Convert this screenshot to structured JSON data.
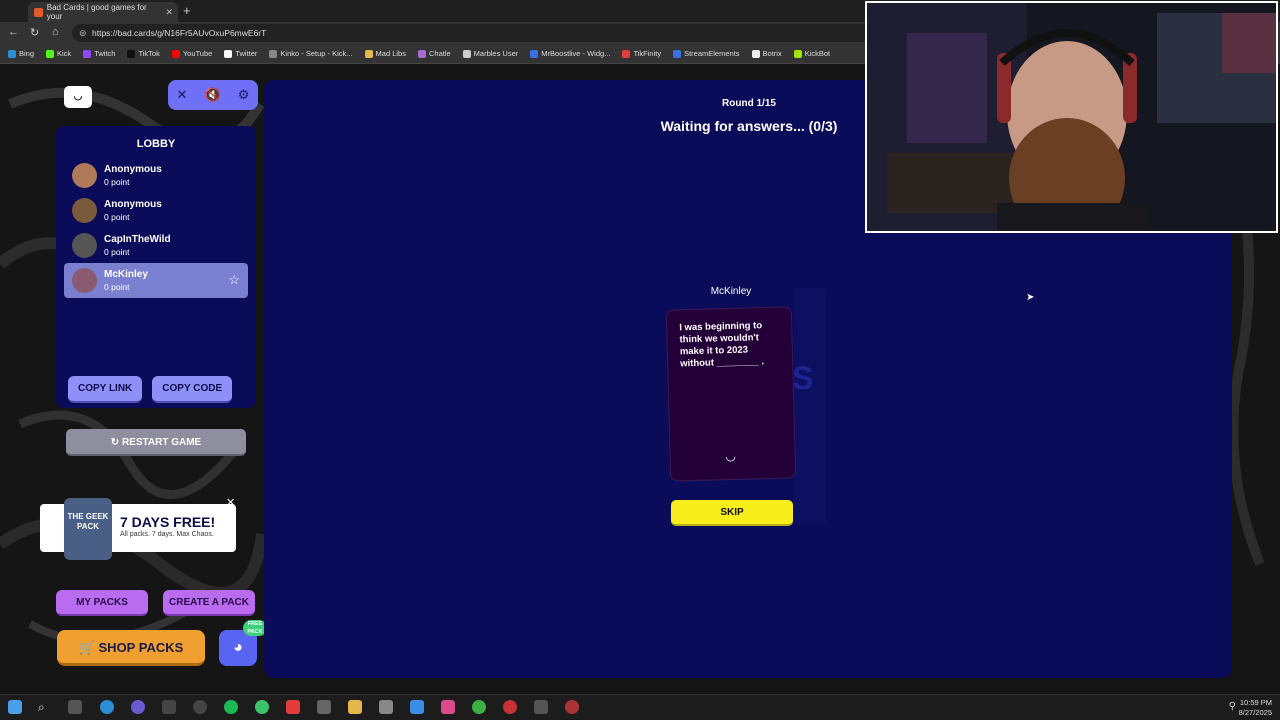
{
  "browser": {
    "tab_title": "Bad Cards | good games for your",
    "url": "https://bad.cards/g/N16Fr5AUvOxuP6mwE6rT",
    "bookmarks": [
      "Bing",
      "Kick",
      "Twitch",
      "TikTok",
      "YouTube",
      "Twitter",
      "Kinko - Setup - Kick...",
      "Mad Libs",
      "Chatle",
      "Marbles User",
      "MrBoostlive - Widg...",
      "TikFinity",
      "StreamElements",
      "Botrix",
      "KickBot"
    ]
  },
  "lobby": {
    "title": "LOBBY",
    "players": [
      {
        "name": "Anonymous",
        "points": "0 point"
      },
      {
        "name": "Anonymous",
        "points": "0 point"
      },
      {
        "name": "CapInTheWild",
        "points": "0 point"
      },
      {
        "name": "McKinley",
        "points": "0 point"
      }
    ],
    "copy_link": "COPY LINK",
    "copy_code": "COPY CODE",
    "restart": "RESTART GAME"
  },
  "promo": {
    "pack_label": "THE GEEK PACK",
    "headline": "7 DAYS FREE!",
    "subline": "All packs. 7 days. Max Chaos."
  },
  "actions": {
    "my_packs": "MY PACKS",
    "create_pack": "CREATE A PACK",
    "shop_packs": "SHOP PACKS",
    "discord_badge": "FREE PACK"
  },
  "game": {
    "round": "Round 1/15",
    "status": "Waiting for answers... (0/3)",
    "card_owner": "McKinley",
    "card_text": "I was beginning to think we wouldn't make it to 2023 without ________ .",
    "skip": "SKIP"
  },
  "system": {
    "time": "10:59 PM",
    "date": "8/27/2025"
  }
}
